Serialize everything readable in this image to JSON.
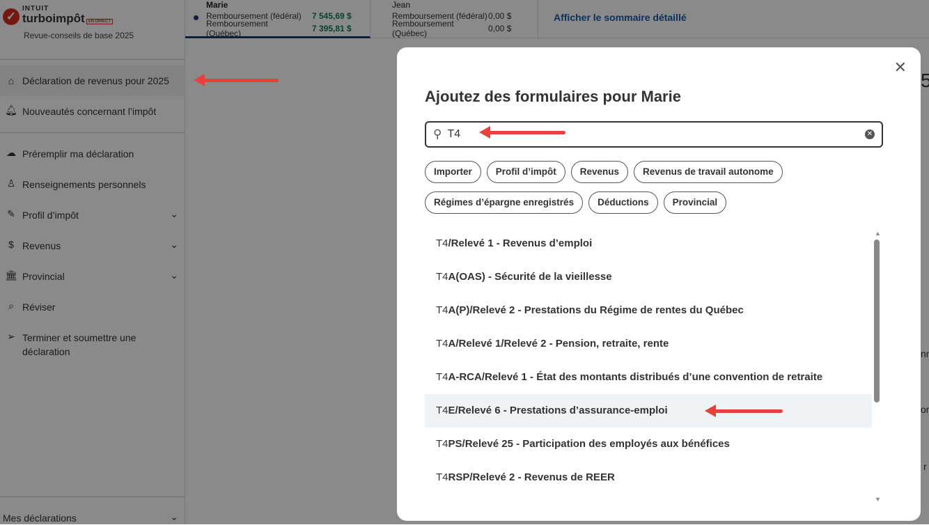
{
  "brand": {
    "intuit": "INTUIT",
    "product": "turboimpôt",
    "badge": "EN DIRECT",
    "subtitle": "Revue-conseils de base 2025"
  },
  "sidebar": {
    "items": [
      {
        "label": "Déclaration de revenus pour 2025",
        "icon": "home-icon"
      },
      {
        "label": "Nouveautés concernant l’impôt",
        "icon": "bell-icon"
      },
      {
        "label": "Préremplir ma déclaration",
        "icon": "cloud-download-icon"
      },
      {
        "label": "Renseignements personnels",
        "icon": "person-icon"
      },
      {
        "label": "Profil d’impôt",
        "icon": "edit-icon"
      },
      {
        "label": "Revenus",
        "icon": "money-hand-icon"
      },
      {
        "label": "Provincial",
        "icon": "bank-icon"
      },
      {
        "label": "Réviser",
        "icon": "review-icon"
      },
      {
        "label": "Terminer et soumettre une déclaration",
        "icon": "send-icon"
      }
    ],
    "footer": "Mes déclarations"
  },
  "topbar": {
    "people": [
      {
        "name": "Marie",
        "rows": [
          {
            "label": "Remboursement (fédéral)",
            "amount": "7 545,69 $"
          },
          {
            "label": "Remboursement (Québec)",
            "amount": "7 395,81 $"
          }
        ]
      },
      {
        "name": "Jean",
        "rows": [
          {
            "label": "Remboursement (fédéral)",
            "amount": "0,00 $"
          },
          {
            "label": "Remboursement (Québec)",
            "amount": "0,00 $"
          }
        ]
      }
    ],
    "summary_link": "Afficher le sommaire détaillé"
  },
  "background_fragments": [
    "5",
    "nn",
    "on",
    "r"
  ],
  "modal": {
    "title": "Ajoutez des formulaires pour Marie",
    "search_value": "T4",
    "chips": [
      "Importer",
      "Profil d’impôt",
      "Revenus",
      "Revenus de travail autonome",
      "Régimes d’épargne enregistrés",
      "Déductions",
      "Provincial"
    ],
    "results": [
      {
        "prefix": "T4",
        "rest": "/Relevé 1 - Revenus d’emploi"
      },
      {
        "prefix": "T4",
        "rest": "A(OAS) - Sécurité de la vieillesse"
      },
      {
        "prefix": "T4",
        "rest": "A(P)/Relevé 2 - Prestations du Régime de rentes du Québec"
      },
      {
        "prefix": "T4",
        "rest": "A/Relevé 1/Relevé 2 - Pension, retraite, rente"
      },
      {
        "prefix": "T4",
        "rest": "A-RCA/Relevé 1 - État des montants distribués d’une convention de retraite"
      },
      {
        "prefix": "T4",
        "rest": "E/Relevé 6 - Prestations d’assurance-emploi"
      },
      {
        "prefix": "T4",
        "rest": "PS/Relevé 25 - Participation des employés aux bénéfices"
      },
      {
        "prefix": "T4",
        "rest": "RSP/Relevé 2 - Revenus de REER"
      }
    ]
  }
}
